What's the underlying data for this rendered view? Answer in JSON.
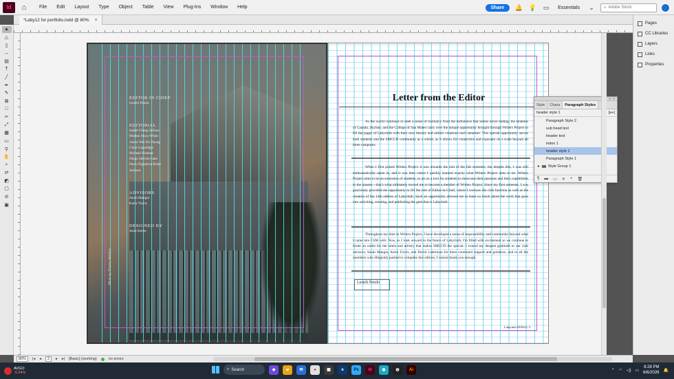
{
  "menubar": {
    "logo": "Id",
    "items": [
      "File",
      "Edit",
      "Layout",
      "Type",
      "Object",
      "Table",
      "View",
      "Plug-Ins",
      "Window",
      "Help"
    ],
    "share_label": "Share",
    "workspace": "Essentials",
    "stock_search_placeholder": "Adobe Stock"
  },
  "document_tab": {
    "title": "*Laby12 for portfolio.indd @ 80%"
  },
  "left_page": {
    "headings": {
      "editor_in_chief": "EDITOR IN CHIEF",
      "editorial": "EDITORIAL",
      "advisors": "ADVISORS",
      "designed_by": "DESIGNED BY"
    },
    "editor_in_chief": [
      "Lesieli Fetolo"
    ],
    "editorial": [
      "Izabel Chang Juliana",
      "Meshni Moni White",
      "Aaron Wei Ali Dayag",
      "Cinar Capalidgis",
      "Michael Kleduer",
      "Diego Salviat-Cano",
      "Paolo Figueiroa Brian",
      "Jackson"
    ],
    "advisors": [
      "Sarah Mangin",
      "Keira Travis"
    ],
    "designed_by": [
      "Jesse Keren"
    ],
    "photo_credit": "Photo by Thomas Mathias"
  },
  "right_page": {
    "title": "Letter from the Editor",
    "paragraphs": [
      "As the world continues to seek a sense of normalcy from the turbulence that seems never ending, the students of Canada, Skyline, and the College of San Mateo carry over the unique opportunity brought through Writers Project to fill the pages of Labyrinth with their own literary and artistic creations each semester. This special opportunity serves both students and the SMCCD community as a whole, as it allows for connection and exposure on a scale beyond all three campuses.",
      "When I first joined Writers Project it was towards the end of the fall semester, but despite this, I was still enthusiastically taken in, and it was then where I quickly learned exactly what Writers Project aims to be. Writers Project aims to be an extension of students, to act as a tool for students to showcase their passions and their capabilities to the masses—that's what ultimately moved me to become a member of Writers Project. Since my first semester, I was graciously provided the opportunity to fill the role of Editor-in-Chief, where I oversaw the club function as well as the creation of the 14th edition of Labyrinth. Such an opportunity allowed me to learn so much about the work that goes into soliciting, creating, and publishing the gem that is Labyrinth.",
      "Throughout my time in Writers Project, I have developed a sense of responsibility and community beyond what I came into CSM with. Now, as I look onward to the future of Labyrinth, I'm filled with excitement as we continue to foster an outlet for the talent and artistry that makes SMCCD the special. I extend my deepest gratitude to our club advisors, Sarah Mangin, Keira Travis, and David Laderman for there continued support and guidance, and to all the members who diligently pushed to complete this edition, I cannot thank you enough."
    ],
    "signature": "Lesieli Fetolo",
    "footer": "Labyrinth SP2024 | 3"
  },
  "paragraph_styles_panel": {
    "tabs": [
      "Style",
      "Chara",
      "Paragraph Styles"
    ],
    "current_style": "header style 1",
    "current_marker": "[a+]",
    "items": [
      "Paragraph Style 2",
      "sub head text",
      "header text",
      "index 1",
      "header style 1",
      "Paragraph Style 1"
    ],
    "selected_index": 4,
    "group": "Style Group 1"
  },
  "right_panels": {
    "items": [
      "Pages",
      "CC Libraries",
      "Layers",
      "Links",
      "Properties"
    ]
  },
  "statusbar": {
    "zoom": "80%",
    "page": "2",
    "preflight_profile": "[Basic] (working)",
    "errors": "no errors"
  },
  "taskbar": {
    "stock_symbol": "AVGO",
    "stock_change": "-5.54%",
    "search_label": "Search",
    "time": "8:28 PM",
    "date": "6/6/2026"
  },
  "colors": {
    "accent": "#1473e6",
    "guide_cyan": "#50dceb",
    "margin_magenta": "#c45ac8",
    "selection": "#a7c4ea"
  }
}
